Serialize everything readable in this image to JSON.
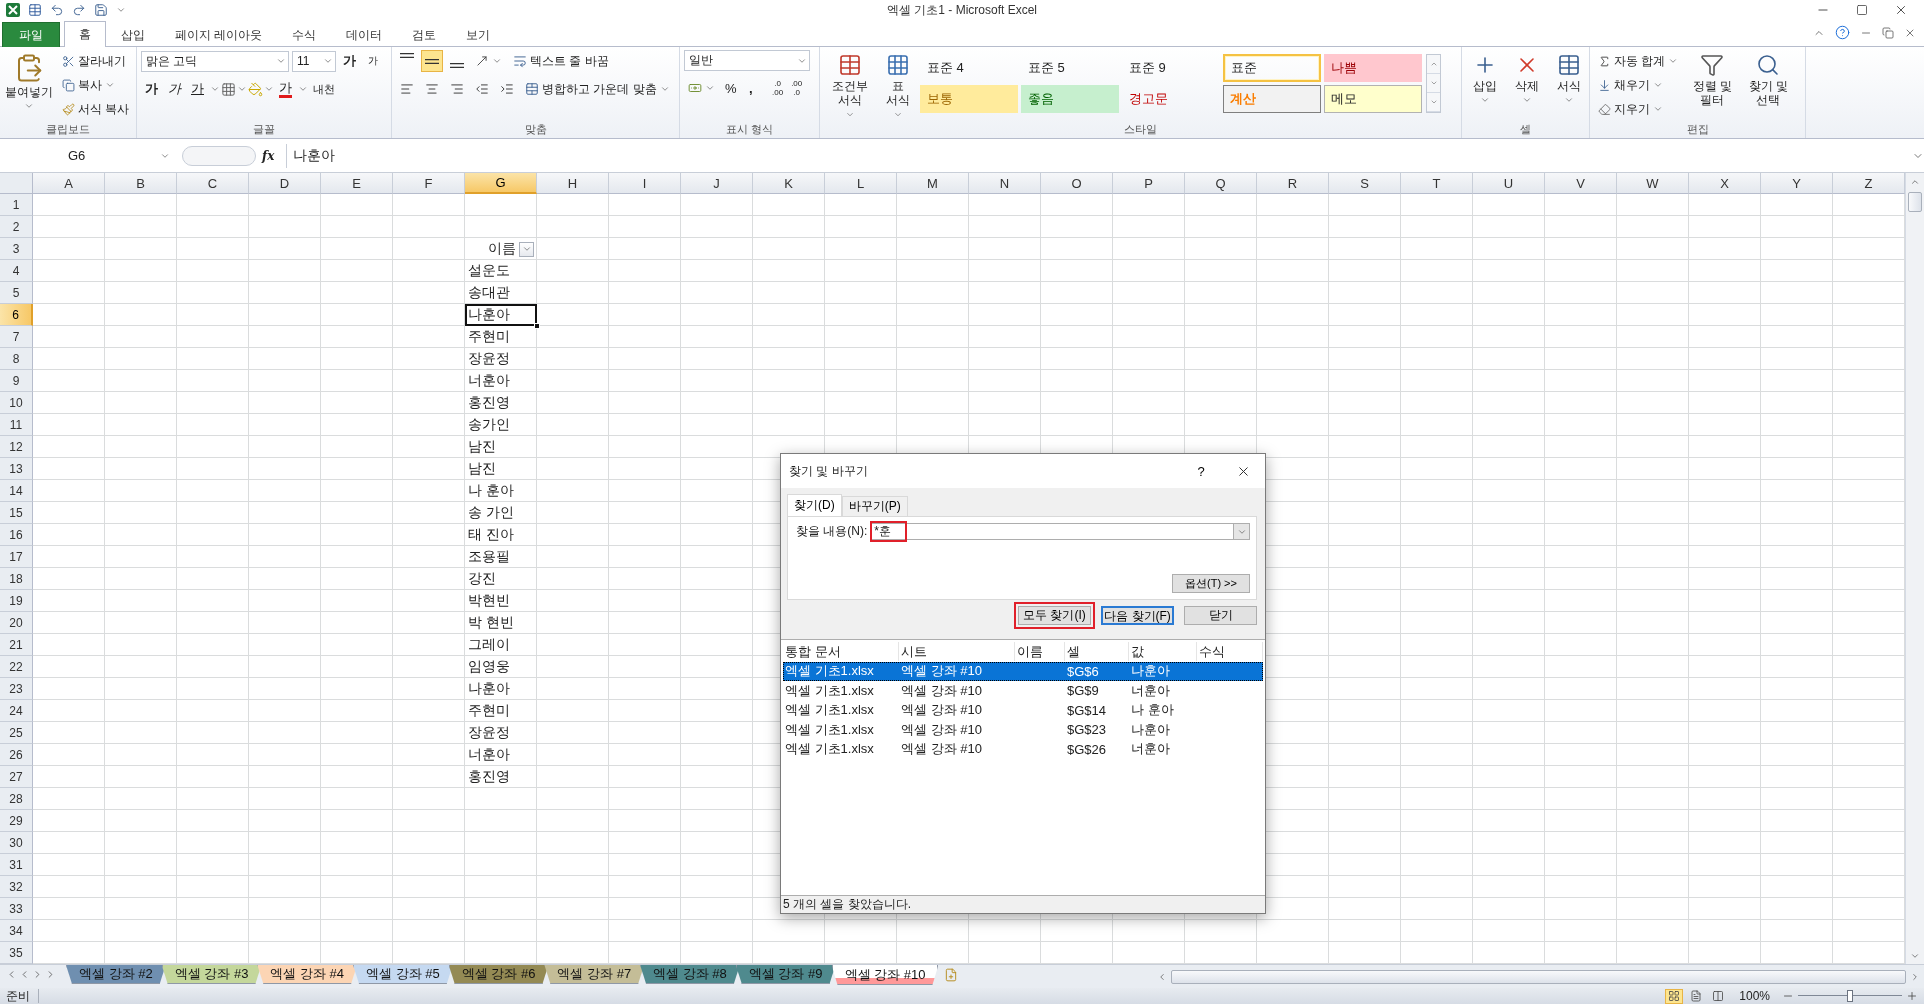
{
  "title_bar": {
    "title": "엑셀 기초1 - Microsoft Excel"
  },
  "ribbon_tabs": [
    {
      "label": "파일",
      "kind": "file",
      "selected": false
    },
    {
      "label": "홈",
      "kind": "tab",
      "selected": true
    },
    {
      "label": "삽입",
      "kind": "tab",
      "selected": false
    },
    {
      "label": "페이지 레이아웃",
      "kind": "tab",
      "selected": false
    },
    {
      "label": "수식",
      "kind": "tab",
      "selected": false
    },
    {
      "label": "데이터",
      "kind": "tab",
      "selected": false
    },
    {
      "label": "검토",
      "kind": "tab",
      "selected": false
    },
    {
      "label": "보기",
      "kind": "tab",
      "selected": false
    }
  ],
  "ribbon": {
    "clipboard": {
      "paste": "붙여넣기",
      "cut": "잘라내기",
      "copy": "복사",
      "format_painter": "서식 복사",
      "label": "클립보드"
    },
    "font": {
      "name": "맑은 고딕",
      "size": "11",
      "grow": "가",
      "shrink": "가",
      "bold": "가",
      "italic": "가",
      "underline": "가",
      "font_color": "가",
      "phonetic": "내천",
      "label": "글꼴"
    },
    "alignment": {
      "vertical": [
        {
          "kind": "top",
          "selected": false
        },
        {
          "kind": "middle",
          "selected": true
        },
        {
          "kind": "bottom",
          "selected": false
        }
      ],
      "wrap": "텍스트 줄 바꿈",
      "merge": "병합하고 가운데 맞춤",
      "label": "맞춤"
    },
    "number": {
      "format": "일반",
      "percent": "%",
      "comma": ",",
      "decimals": [
        {
          "top": ".0",
          "bottom": ".00"
        },
        {
          "top": ".00",
          "bottom": ".0"
        }
      ],
      "label": "표시 형식"
    },
    "styles": {
      "conditional": "조건부 서식",
      "table": "표 서식",
      "cells": [
        {
          "label": "표준 4",
          "kind": "plain",
          "selected": false
        },
        {
          "label": "표준 5",
          "kind": "plain",
          "selected": false
        },
        {
          "label": "표준 9",
          "kind": "plain",
          "selected": false
        },
        {
          "label": "표준",
          "kind": "plain",
          "selected": true
        },
        {
          "label": "나쁨",
          "kind": "bad",
          "selected": false
        },
        {
          "label": "보통",
          "kind": "neutral",
          "selected": false
        },
        {
          "label": "좋음",
          "kind": "good",
          "selected": false
        },
        {
          "label": "경고문",
          "kind": "warning",
          "selected": false
        },
        {
          "label": "계산",
          "kind": "calc",
          "selected": false
        },
        {
          "label": "메모",
          "kind": "note",
          "selected": false
        }
      ],
      "label": "스타일"
    },
    "cells": {
      "insert": "삽입",
      "delete": "삭제",
      "format": "서식",
      "label": "셀"
    },
    "editing": {
      "autosum": "자동 합계",
      "fill": "채우기",
      "clear": "지우기",
      "sort": "정렬 및 필터",
      "find": "찾기 및 선택",
      "label": "편집"
    }
  },
  "formula_bar": {
    "name_box": "G6",
    "fx": "fx",
    "value": "나훈아"
  },
  "columns": [
    {
      "label": "A",
      "selected": false
    },
    {
      "label": "B",
      "selected": false
    },
    {
      "label": "C",
      "selected": false
    },
    {
      "label": "D",
      "selected": false
    },
    {
      "label": "E",
      "selected": false
    },
    {
      "label": "F",
      "selected": false
    },
    {
      "label": "G",
      "selected": true
    },
    {
      "label": "H",
      "selected": false
    },
    {
      "label": "I",
      "selected": false
    },
    {
      "label": "J",
      "selected": false
    },
    {
      "label": "K",
      "selected": false
    },
    {
      "label": "L",
      "selected": false
    },
    {
      "label": "M",
      "selected": false
    },
    {
      "label": "N",
      "selected": false
    },
    {
      "label": "O",
      "selected": false
    },
    {
      "label": "P",
      "selected": false
    },
    {
      "label": "Q",
      "selected": false
    },
    {
      "label": "R",
      "selected": false
    },
    {
      "label": "S",
      "selected": false
    },
    {
      "label": "T",
      "selected": false
    },
    {
      "label": "U",
      "selected": false
    },
    {
      "label": "V",
      "selected": false
    },
    {
      "label": "W",
      "selected": false
    },
    {
      "label": "X",
      "selected": false
    },
    {
      "label": "Y",
      "selected": false
    },
    {
      "label": "Z",
      "selected": false
    }
  ],
  "rows": [
    {
      "number": "1",
      "kind": "empty",
      "selected": false
    },
    {
      "number": "2",
      "kind": "empty",
      "selected": false
    },
    {
      "number": "3",
      "kind": "header",
      "selected": false,
      "g": "이름"
    },
    {
      "number": "4",
      "kind": "data",
      "selected": false,
      "g": "설운도"
    },
    {
      "number": "5",
      "kind": "data",
      "selected": false,
      "g": "송대관"
    },
    {
      "number": "6",
      "kind": "data",
      "selected": true,
      "g": "나훈아"
    },
    {
      "number": "7",
      "kind": "data",
      "selected": false,
      "g": "주현미"
    },
    {
      "number": "8",
      "kind": "data",
      "selected": false,
      "g": "장윤정"
    },
    {
      "number": "9",
      "kind": "data",
      "selected": false,
      "g": "너훈아"
    },
    {
      "number": "10",
      "kind": "data",
      "selected": false,
      "g": "홍진영"
    },
    {
      "number": "11",
      "kind": "data",
      "selected": false,
      "g": "송가인"
    },
    {
      "number": "12",
      "kind": "data",
      "selected": false,
      "g": "남진"
    },
    {
      "number": "13",
      "kind": "data",
      "selected": false,
      "g": "남진"
    },
    {
      "number": "14",
      "kind": "data",
      "selected": false,
      "g": "나 훈아"
    },
    {
      "number": "15",
      "kind": "data",
      "selected": false,
      "g": "송 가인"
    },
    {
      "number": "16",
      "kind": "data",
      "selected": false,
      "g": "태 진아"
    },
    {
      "number": "17",
      "kind": "data",
      "selected": false,
      "g": "조용필"
    },
    {
      "number": "18",
      "kind": "data",
      "selected": false,
      "g": "강진"
    },
    {
      "number": "19",
      "kind": "data",
      "selected": false,
      "g": "박현빈"
    },
    {
      "number": "20",
      "kind": "data",
      "selected": false,
      "g": "박 현빈"
    },
    {
      "number": "21",
      "kind": "data",
      "selected": false,
      "g": "그레이"
    },
    {
      "number": "22",
      "kind": "data",
      "selected": false,
      "g": "임영웅"
    },
    {
      "number": "23",
      "kind": "data",
      "selected": false,
      "g": "나훈아"
    },
    {
      "number": "24",
      "kind": "data",
      "selected": false,
      "g": "주현미"
    },
    {
      "number": "25",
      "kind": "data",
      "selected": false,
      "g": "장윤정"
    },
    {
      "number": "26",
      "kind": "data",
      "selected": false,
      "g": "너훈아"
    },
    {
      "number": "27",
      "kind": "data",
      "selected": false,
      "g": "홍진영"
    },
    {
      "number": "28",
      "kind": "empty",
      "selected": false
    },
    {
      "number": "29",
      "kind": "empty",
      "selected": false
    },
    {
      "number": "30",
      "kind": "empty",
      "selected": false
    },
    {
      "number": "31",
      "kind": "empty",
      "selected": false
    },
    {
      "number": "32",
      "kind": "empty",
      "selected": false
    },
    {
      "number": "33",
      "kind": "empty",
      "selected": false
    },
    {
      "number": "34",
      "kind": "empty",
      "selected": false
    },
    {
      "number": "35",
      "kind": "empty",
      "selected": false
    }
  ],
  "sheet_tabs": [
    {
      "label": "엑셀 강좌 #2",
      "color": "#6f8fb0",
      "selected": false
    },
    {
      "label": "엑셀 강좌 #3",
      "color": "#c4d79b",
      "selected": false
    },
    {
      "label": "엑셀 강좌 #4",
      "color": "#fcd5b4",
      "selected": false
    },
    {
      "label": "엑셀 강좌 #5",
      "color": "#c5d9f1",
      "selected": false
    },
    {
      "label": "엑셀 강좌 #6",
      "color": "#948a54",
      "selected": false
    },
    {
      "label": "엑셀 강좌 #7",
      "color": "#c4bd97",
      "selected": false
    },
    {
      "label": "엑셀 강좌 #8",
      "color": "#4f8a8e",
      "selected": false
    },
    {
      "label": "엑셀 강좌 #9",
      "color": "#4f8a8e",
      "selected": false
    },
    {
      "label": "엑셀 강좌 #10",
      "color": "#ff9999",
      "selected": true
    }
  ],
  "status_bar": {
    "status": "준비",
    "views": [
      {
        "kind": "normal",
        "selected": true
      },
      {
        "kind": "page_layout",
        "selected": false
      },
      {
        "kind": "page_break",
        "selected": false
      }
    ],
    "zoom": {
      "label": "100%",
      "level": 0.5
    }
  },
  "dialog": {
    "title": "찾기 및 바꾸기",
    "help": "?",
    "tabs": [
      {
        "label": "찾기(D)",
        "selected": true
      },
      {
        "label": "바꾸기(P)",
        "selected": false
      }
    ],
    "find_label": "찾을 내용(N):",
    "find_value": "*훈",
    "find_marked": true,
    "options": "옵션(T) >>",
    "buttons": [
      {
        "label": "모두 찾기(I)",
        "kind": "marked"
      },
      {
        "label": "다음 찾기(F)",
        "kind": "default"
      },
      {
        "label": "닫기",
        "kind": "plain"
      }
    ],
    "columns": [
      "통합 문서",
      "시트",
      "이름",
      "셀",
      "값",
      "수식"
    ],
    "results": [
      {
        "workbook": "엑셀 기초1.xlsx",
        "sheet": "엑셀 강좌 #10",
        "cell": "$G$6",
        "value": "나훈아",
        "selected": true
      },
      {
        "workbook": "엑셀 기초1.xlsx",
        "sheet": "엑셀 강좌 #10",
        "cell": "$G$9",
        "value": "너훈아",
        "selected": false
      },
      {
        "workbook": "엑셀 기초1.xlsx",
        "sheet": "엑셀 강좌 #10",
        "cell": "$G$14",
        "value": "나 훈아",
        "selected": false
      },
      {
        "workbook": "엑셀 기초1.xlsx",
        "sheet": "엑셀 강좌 #10",
        "cell": "$G$23",
        "value": "나훈아",
        "selected": false
      },
      {
        "workbook": "엑셀 기초1.xlsx",
        "sheet": "엑셀 강좌 #10",
        "cell": "$G$26",
        "value": "너훈아",
        "selected": false
      }
    ],
    "status": "5 개의 셀을 찾았습니다."
  }
}
